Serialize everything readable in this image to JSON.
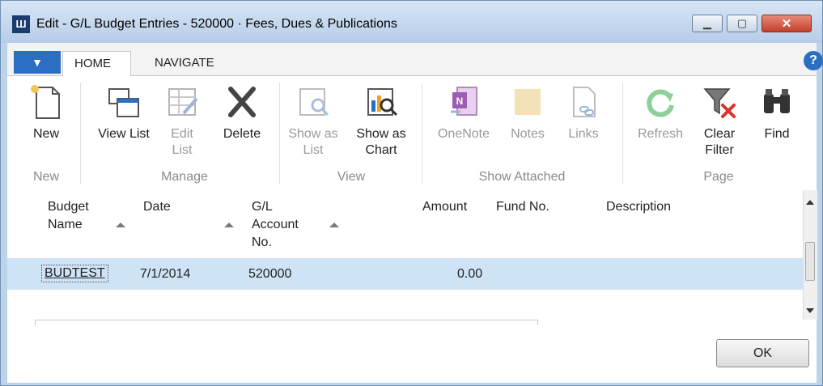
{
  "window": {
    "title": "Edit - G/L Budget Entries - 520000 · Fees, Dues & Publications",
    "app_icon_text": "Ш"
  },
  "tabs": {
    "app_menu_glyph": "▼",
    "items": [
      "HOME",
      "NAVIGATE"
    ],
    "help_glyph": "?"
  },
  "ribbon": {
    "buttons": {
      "new": "New",
      "view_list": "View List",
      "edit_list": "Edit List",
      "delete": "Delete",
      "show_as_list": "Show as List",
      "show_as_chart": "Show as Chart",
      "onenote": "OneNote",
      "notes": "Notes",
      "links": "Links",
      "refresh": "Refresh",
      "clear_filter": "Clear Filter",
      "find": "Find"
    },
    "groups": [
      "New",
      "Manage",
      "View",
      "Show Attached",
      "Page"
    ]
  },
  "grid": {
    "columns": [
      "Budget Name",
      "Date",
      "G/L Account No.",
      "Amount",
      "Fund No.",
      "Description"
    ],
    "rows": [
      {
        "budget_name": "BUDTEST",
        "date": "7/1/2014",
        "gl_account_no": "520000",
        "amount": "0.00",
        "fund_no": "",
        "description": ""
      }
    ]
  },
  "footer": {
    "ok_label": "OK"
  },
  "colors": {
    "accent": "#2b6fc2",
    "selected_row": "#cfe3f6",
    "close_button": "#c3402c"
  }
}
